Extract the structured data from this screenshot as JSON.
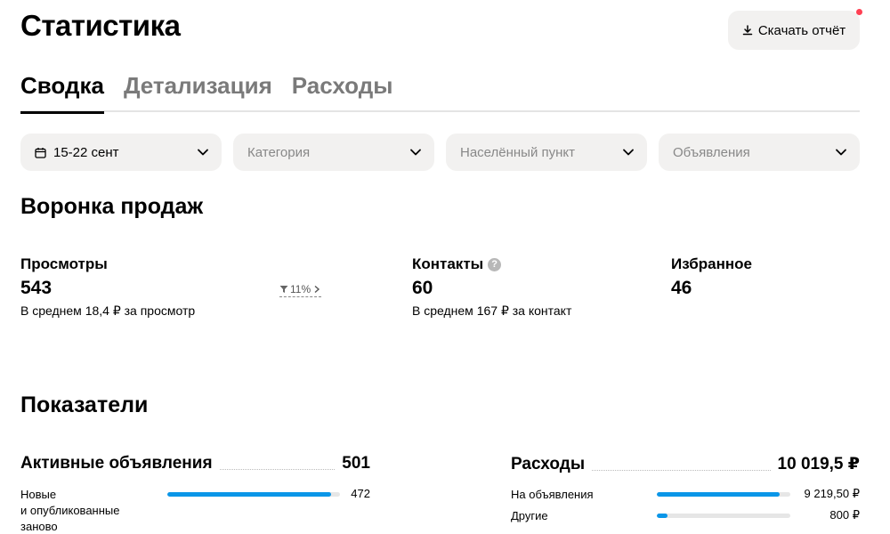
{
  "header": {
    "title": "Статистика",
    "download_label": "Скачать отчёт"
  },
  "tabs": [
    {
      "label": "Сводка",
      "active": true
    },
    {
      "label": "Детализация",
      "active": false
    },
    {
      "label": "Расходы",
      "active": false
    }
  ],
  "filters": {
    "date": "15-22 сент",
    "category": "Категория",
    "location": "Населённый пункт",
    "ads": "Объявления"
  },
  "funnel": {
    "title": "Воронка продаж",
    "views": {
      "label": "Просмотры",
      "value": "543",
      "sub": "В среднем 18,4 ₽ за просмотр",
      "conversion": "11%"
    },
    "contacts": {
      "label": "Контакты",
      "value": "60",
      "sub": "В среднем 167 ₽ за контакт",
      "help": "?"
    },
    "favorites": {
      "label": "Избранное",
      "value": "46"
    }
  },
  "indicators": {
    "title": "Показатели",
    "active_ads": {
      "label": "Активные объявления",
      "value": "501",
      "rows": [
        {
          "label_lines": [
            "Новые",
            "и опубликованные",
            "заново"
          ],
          "value": "472",
          "fraction": 0.95
        }
      ]
    },
    "expenses": {
      "label": "Расходы",
      "value": "10 019,5 ₽",
      "rows": [
        {
          "label": "На объявления",
          "value": "9 219,50 ₽",
          "fraction": 0.92
        },
        {
          "label": "Другие",
          "value": "800 ₽",
          "fraction": 0.08
        }
      ]
    }
  },
  "colors": {
    "accent_bar": "#0a96e8",
    "notify_dot": "#ff4053",
    "control_bg": "#f2f1f0"
  }
}
